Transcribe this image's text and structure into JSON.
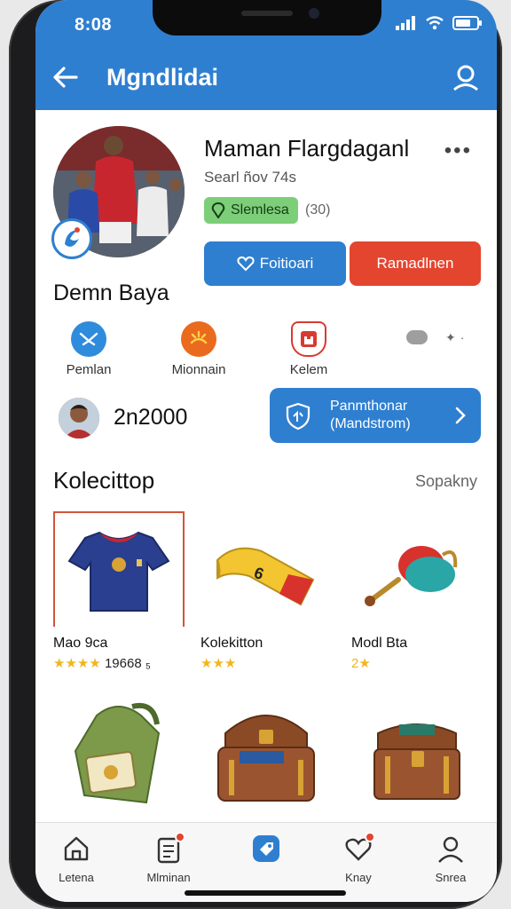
{
  "status": {
    "time": "8:08"
  },
  "appbar": {
    "title": "Mgndlidai"
  },
  "profile": {
    "name": "Maman Flargdaganl",
    "subinfo": "Searl ñov 74s",
    "pill_label": "Slemlesa",
    "count": "(30)",
    "btn_primary": "Foitioari",
    "btn_secondary": "Ramadlnen"
  },
  "section_name": "Demn Baya",
  "categories": [
    {
      "label": "Pemlan",
      "icon": "swords-icon",
      "color": "#2f8bdc"
    },
    {
      "label": "Mionnain",
      "icon": "sun-burst-icon",
      "color": "#ea6a1e"
    },
    {
      "label": "Kelem",
      "icon": "castle-shield-icon",
      "color": "#d83a31"
    }
  ],
  "coins": {
    "value": "2n2000"
  },
  "promo": {
    "line1": "Panmthonar",
    "line2": "(Mandstrom)"
  },
  "collection": {
    "title": "Kolecittop",
    "see_all": "Sopakny",
    "items": [
      {
        "title": "Mao 9ca",
        "stars": "★★★★",
        "extra": "19668 ₅",
        "icon": "jersey-icon"
      },
      {
        "title": "Kolekitton",
        "stars": "★★★",
        "extra": "",
        "icon": "scarf-icon"
      },
      {
        "title": "Modl Bta",
        "stars": "2★",
        "extra": "",
        "icon": "trumpet-icon"
      },
      {
        "title": "",
        "stars": "",
        "extra": "",
        "icon": "backpack-icon"
      },
      {
        "title": "",
        "stars": "",
        "extra": "",
        "icon": "treasure-chest-icon"
      },
      {
        "title": "",
        "stars": "",
        "extra": "",
        "icon": "chest-icon"
      }
    ]
  },
  "nav": [
    {
      "label": "Letena",
      "icon": "home-icon"
    },
    {
      "label": "Mlminan",
      "icon": "clipboard-icon"
    },
    {
      "label": "",
      "icon": "tag-icon"
    },
    {
      "label": "Knay",
      "icon": "heart-icon"
    },
    {
      "label": "Snrea",
      "icon": "user-icon"
    }
  ],
  "colors": {
    "primary": "#2f7fd0",
    "danger": "#e3452f",
    "success": "#7dce78",
    "star": "#f2b51d"
  }
}
